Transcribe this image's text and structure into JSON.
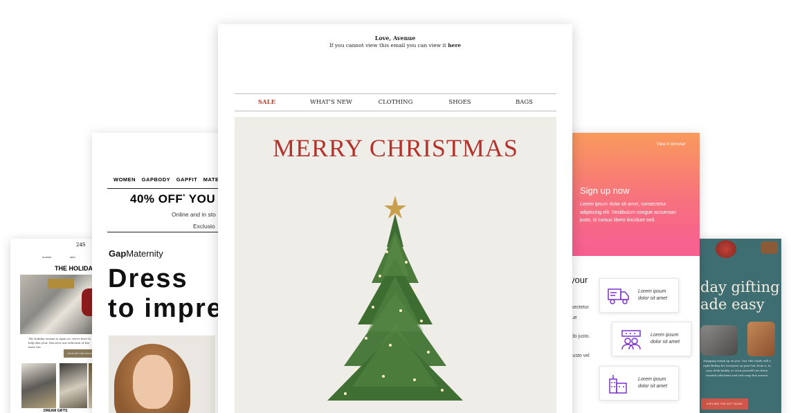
{
  "card_24s": {
    "logo": "24S",
    "nav": [
      "WOMEN",
      "MEN"
    ],
    "title": "THE HOLIDAY",
    "body": "The holiday season is upon us: we're here to help this year. Discover our selection of the most exc",
    "button": "KICK OFF THE FESTIV",
    "footer": "DREAM GIFTS"
  },
  "card_gap": {
    "nav": [
      "WOMEN",
      "GAPBODY",
      "GAPFIT",
      "MATERNIT"
    ],
    "promo": "40% OFF",
    "promo_mark": "*",
    "promo_rest": " YOU",
    "sub1": "Online and in sto",
    "sub2": "Exclusio",
    "brand_bold": "Gap",
    "brand_rest": "Maternity",
    "headline_1": "Dress",
    "headline_2": "to impre"
  },
  "card_main": {
    "sender": "Love, Avenue",
    "view_text": "If you cannot view this email you can view it ",
    "view_link": "here",
    "nav": [
      "SALE",
      "WHAT'S NEW",
      "CLOTHING",
      "SHOES",
      "BAGS"
    ],
    "banner_title": "MERRY CHRISTMAS"
  },
  "card_signup": {
    "view_browser": "View in browser",
    "heading": "Sign up now",
    "body": "Lorem ipsum dolor sit amet, consectetur adipiscing elit. Vestibulum congue accumsan justo, id cursus libero tincidunt sed.",
    "peek_heading": "your",
    "peek_lines": [
      "sectetur",
      "ue",
      "do justo.",
      "justo vel"
    ],
    "features": [
      {
        "icon": "truck-icon",
        "text": "Lorem ipsum dolor sit amet"
      },
      {
        "icon": "users-chat-icon",
        "text": "Lorem ipsum dolor sit amet"
      },
      {
        "icon": "buildings-icon",
        "text": "Lorem ipsum dolor sit amet"
      }
    ]
  },
  "card_gift": {
    "heading_1": "day gifting",
    "heading_2": "ade easy",
    "body": "shopping sneak up on you. Our Gift Guide will e right BeBuy for everyone on your list, from n, to your desk buddy, or even yourself (we these curated selections and rest easy this season.",
    "button": "EXPLORE THE GIFT GUIDE"
  },
  "colors": {
    "sale_red": "#c0392b",
    "christmas_red": "#b3322c",
    "signup_gradient_top": "#f99a5c",
    "signup_gradient_bottom": "#f75e93",
    "feature_icon_purple": "#7b2fd0",
    "gift_teal": "#3f6e72",
    "gift_button": "#cf5648"
  }
}
